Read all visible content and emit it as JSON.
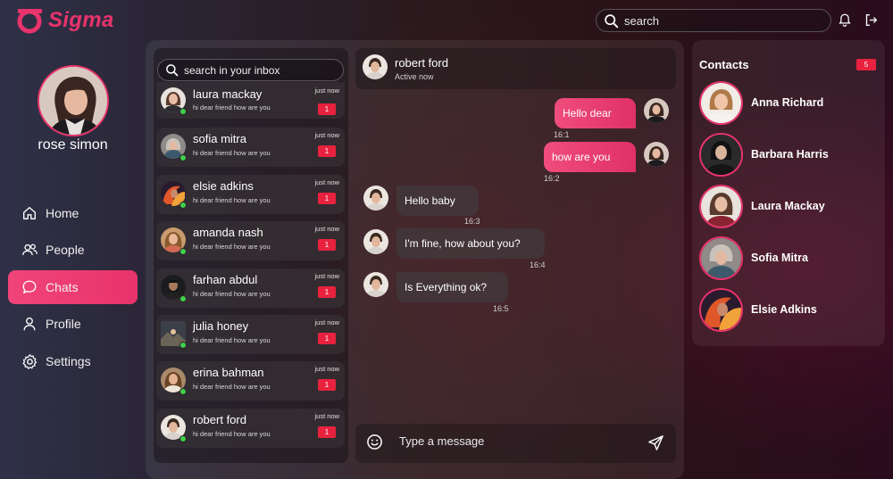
{
  "app": {
    "name": "Sigma"
  },
  "colors": {
    "accent": "#e8336b",
    "badge": "#e8223e",
    "online": "#3fd14a"
  },
  "header": {
    "search_placeholder": "search",
    "icons": [
      "bell-icon",
      "logout-icon"
    ]
  },
  "profile": {
    "name": "rose simon"
  },
  "nav": [
    {
      "label": "Home",
      "icon": "home-icon",
      "active": false
    },
    {
      "label": "People",
      "icon": "people-icon",
      "active": false
    },
    {
      "label": "Chats",
      "icon": "chat-bubble-icon",
      "active": true
    },
    {
      "label": "Profile",
      "icon": "user-icon",
      "active": false
    },
    {
      "label": "Settings",
      "icon": "gear-icon",
      "active": false
    }
  ],
  "inbox": {
    "search_placeholder": "search in your inbox",
    "chats": [
      {
        "name": "laura mackay",
        "message": "hi dear friend how are you",
        "time": "just now",
        "unread": "1"
      },
      {
        "name": "sofia mitra",
        "message": "hi dear friend how are you",
        "time": "just now",
        "unread": "1"
      },
      {
        "name": "elsie adkins",
        "message": "hi dear friend how are you",
        "time": "just now",
        "unread": "1"
      },
      {
        "name": "amanda nash",
        "message": "hi dear friend how are you",
        "time": "just now",
        "unread": "1"
      },
      {
        "name": "farhan abdul",
        "message": "hi dear friend how are you",
        "time": "just now",
        "unread": "1"
      },
      {
        "name": "julia honey",
        "message": "hi dear friend how are you",
        "time": "just now",
        "unread": "1"
      },
      {
        "name": "erina bahman",
        "message": "hi dear friend how are you",
        "time": "just now",
        "unread": "1"
      },
      {
        "name": "robert ford",
        "message": "hi dear friend how are you",
        "time": "just now",
        "unread": "1"
      }
    ]
  },
  "conversation": {
    "contact_name": "robert ford",
    "status": "Active now",
    "messages": [
      {
        "direction": "out",
        "text": "Hello dear",
        "time": "16:1"
      },
      {
        "direction": "out",
        "text": "how are you",
        "time": "16:2"
      },
      {
        "direction": "in",
        "text": "Hello baby",
        "time": "16:3"
      },
      {
        "direction": "in",
        "text": "I'm fine, how about you?",
        "time": "16:4"
      },
      {
        "direction": "in",
        "text": "Is Everything ok?",
        "time": "16:5"
      }
    ],
    "composer_placeholder": "Type a message"
  },
  "contacts": {
    "title": "Contacts",
    "count": "5",
    "items": [
      {
        "name": "Anna Richard"
      },
      {
        "name": "Barbara Harris"
      },
      {
        "name": "Laura Mackay"
      },
      {
        "name": "Sofia Mitra"
      },
      {
        "name": "Elsie Adkins"
      }
    ]
  }
}
